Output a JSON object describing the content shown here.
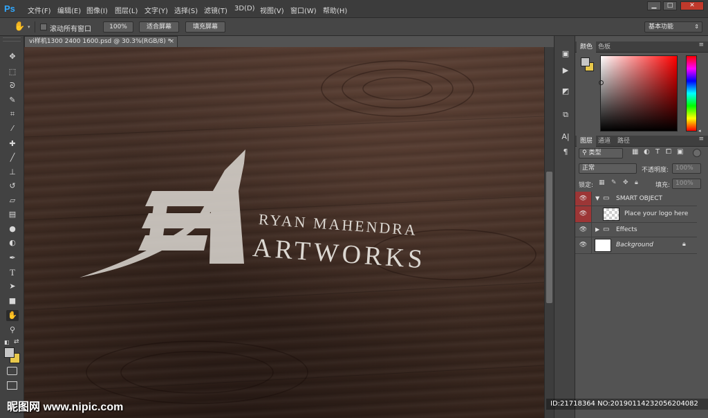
{
  "app": {
    "logo": "Ps",
    "menu": [
      "文件(F)",
      "编辑(E)",
      "图像(I)",
      "图层(L)",
      "文字(Y)",
      "选择(S)",
      "滤镜(T)",
      "3D(D)",
      "视图(V)",
      "窗口(W)",
      "帮助(H)"
    ],
    "window_controls": {
      "minimize": "▁",
      "maximize": "□",
      "close": "✕"
    }
  },
  "options_bar": {
    "tool_icon": "hand-icon",
    "scroll_all_label": "滚动所有窗口",
    "buttons": [
      "100%",
      "适合屏幕",
      "填充屏幕"
    ],
    "workspace": "基本功能"
  },
  "document": {
    "tab_title": "vi样机1300 2400 1600.psd @ 30.3%(RGB/8) *",
    "logo_line1": "RYAN MAHENDRA",
    "logo_line2": "ARTWORKS"
  },
  "tools": [
    "move-icon",
    "marquee-icon",
    "lasso-icon",
    "quick-select-icon",
    "crop-icon",
    "eyedropper-icon",
    "healing-icon",
    "brush-icon",
    "stamp-icon",
    "history-brush-icon",
    "eraser-icon",
    "gradient-icon",
    "blur-icon",
    "dodge-icon",
    "pen-icon",
    "type-icon",
    "path-select-icon",
    "rectangle-icon",
    "hand-icon",
    "zoom-icon"
  ],
  "color_panel": {
    "tabs": [
      "颜色",
      "色板"
    ],
    "foreground": "#c6c6c6",
    "background": "#e8c84a"
  },
  "layers_panel": {
    "tabs": [
      "图层",
      "通道",
      "路径"
    ],
    "filter_kind": "类型",
    "blend_mode": "正常",
    "opacity_label": "不透明度:",
    "opacity_value": "100%",
    "lock_label": "锁定:",
    "fill_label": "填充:",
    "fill_value": "100%",
    "layers": [
      {
        "name": "SMART OBJECT",
        "type": "group",
        "expanded": true
      },
      {
        "name": "Place your logo here",
        "type": "smart-object"
      },
      {
        "name": "Effects",
        "type": "group",
        "expanded": false
      },
      {
        "name": "Background",
        "type": "background",
        "locked": true
      }
    ]
  },
  "overlay": {
    "watermark": "昵图网 www.nipic.com",
    "id_line": "ID:21718364 NO:20190114232056204082"
  }
}
